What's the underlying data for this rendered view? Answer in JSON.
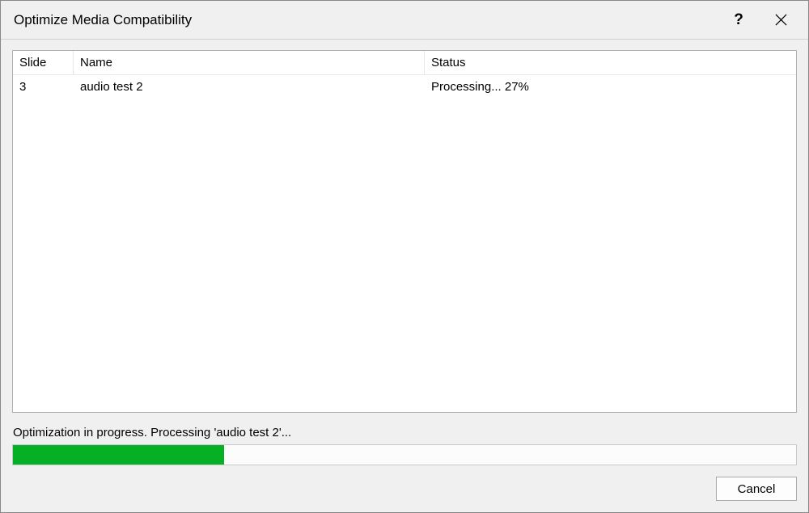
{
  "dialog": {
    "title": "Optimize Media Compatibility"
  },
  "columns": {
    "slide": "Slide",
    "name": "Name",
    "status": "Status"
  },
  "rows": [
    {
      "slide": "3",
      "name": "audio test 2",
      "status": "Processing... 27%"
    }
  ],
  "status_text": "Optimization in progress. Processing 'audio test 2'...",
  "progress": {
    "percent": 27
  },
  "buttons": {
    "cancel": "Cancel"
  }
}
